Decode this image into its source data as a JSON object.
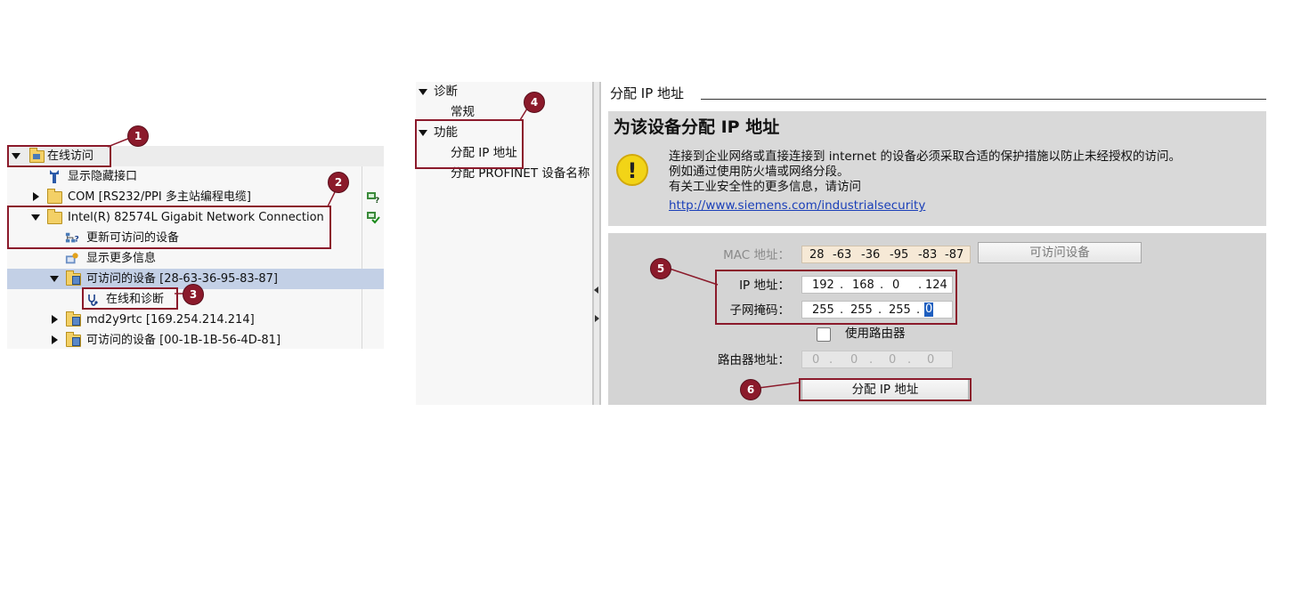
{
  "tree": {
    "root": "在线访问",
    "show_hidden": "显示隐藏接口",
    "com": "COM [RS232/PPI 多主站编程电缆]",
    "intel": "Intel(R) 82574L Gigabit Network Connection",
    "update": "更新可访问的设备",
    "more_info": "显示更多信息",
    "accessible1": "可访问的设备 [28-63-36-95-83-87]",
    "online_diag": "在线和诊断",
    "md2": "md2y9rtc [169.254.214.214]",
    "accessible2": "可访问的设备 [00-1B-1B-56-4D-81]"
  },
  "nav": {
    "diag": "诊断",
    "general": "常规",
    "functions": "功能",
    "assign_ip": "分配 IP 地址",
    "assign_name": "分配 PROFINET 设备名称"
  },
  "content": {
    "section_title": "分配 IP 地址",
    "heading": "为该设备分配 IP 地址",
    "warn_line1": "连接到企业网络或直接连接到 internet 的设备必须采取合适的保护措施以防止未经授权的访问。",
    "warn_line2": "例如通过使用防火墙或网络分段。",
    "warn_line3": "有关工业安全性的更多信息，请访问",
    "link": "http://www.siemens.com/industrialsecurity",
    "warn_icon": "!"
  },
  "form": {
    "mac_label": "MAC 地址：",
    "mac": [
      "28",
      "-63",
      "-36",
      "-95",
      "-83",
      "-87"
    ],
    "accessible_btn": "可访问设备",
    "ip_label": "IP 地址：",
    "ip": [
      "192",
      ".",
      "168",
      ".",
      "0",
      ".",
      "124"
    ],
    "mask_label": "子网掩码：",
    "mask": [
      "255",
      ".",
      "255",
      ".",
      "255",
      ".",
      "0"
    ],
    "use_router": "使用路由器",
    "router_label": "路由器地址：",
    "router": [
      "0",
      ".",
      "0",
      ".",
      "0",
      ".",
      "0"
    ],
    "assign_btn": "分配 IP 地址"
  },
  "badges": [
    "1",
    "2",
    "3",
    "4",
    "5",
    "6"
  ],
  "colors": {
    "annotation": "#8b1a2b",
    "selection": "#c3d0e6",
    "link": "#1a3fb8"
  }
}
